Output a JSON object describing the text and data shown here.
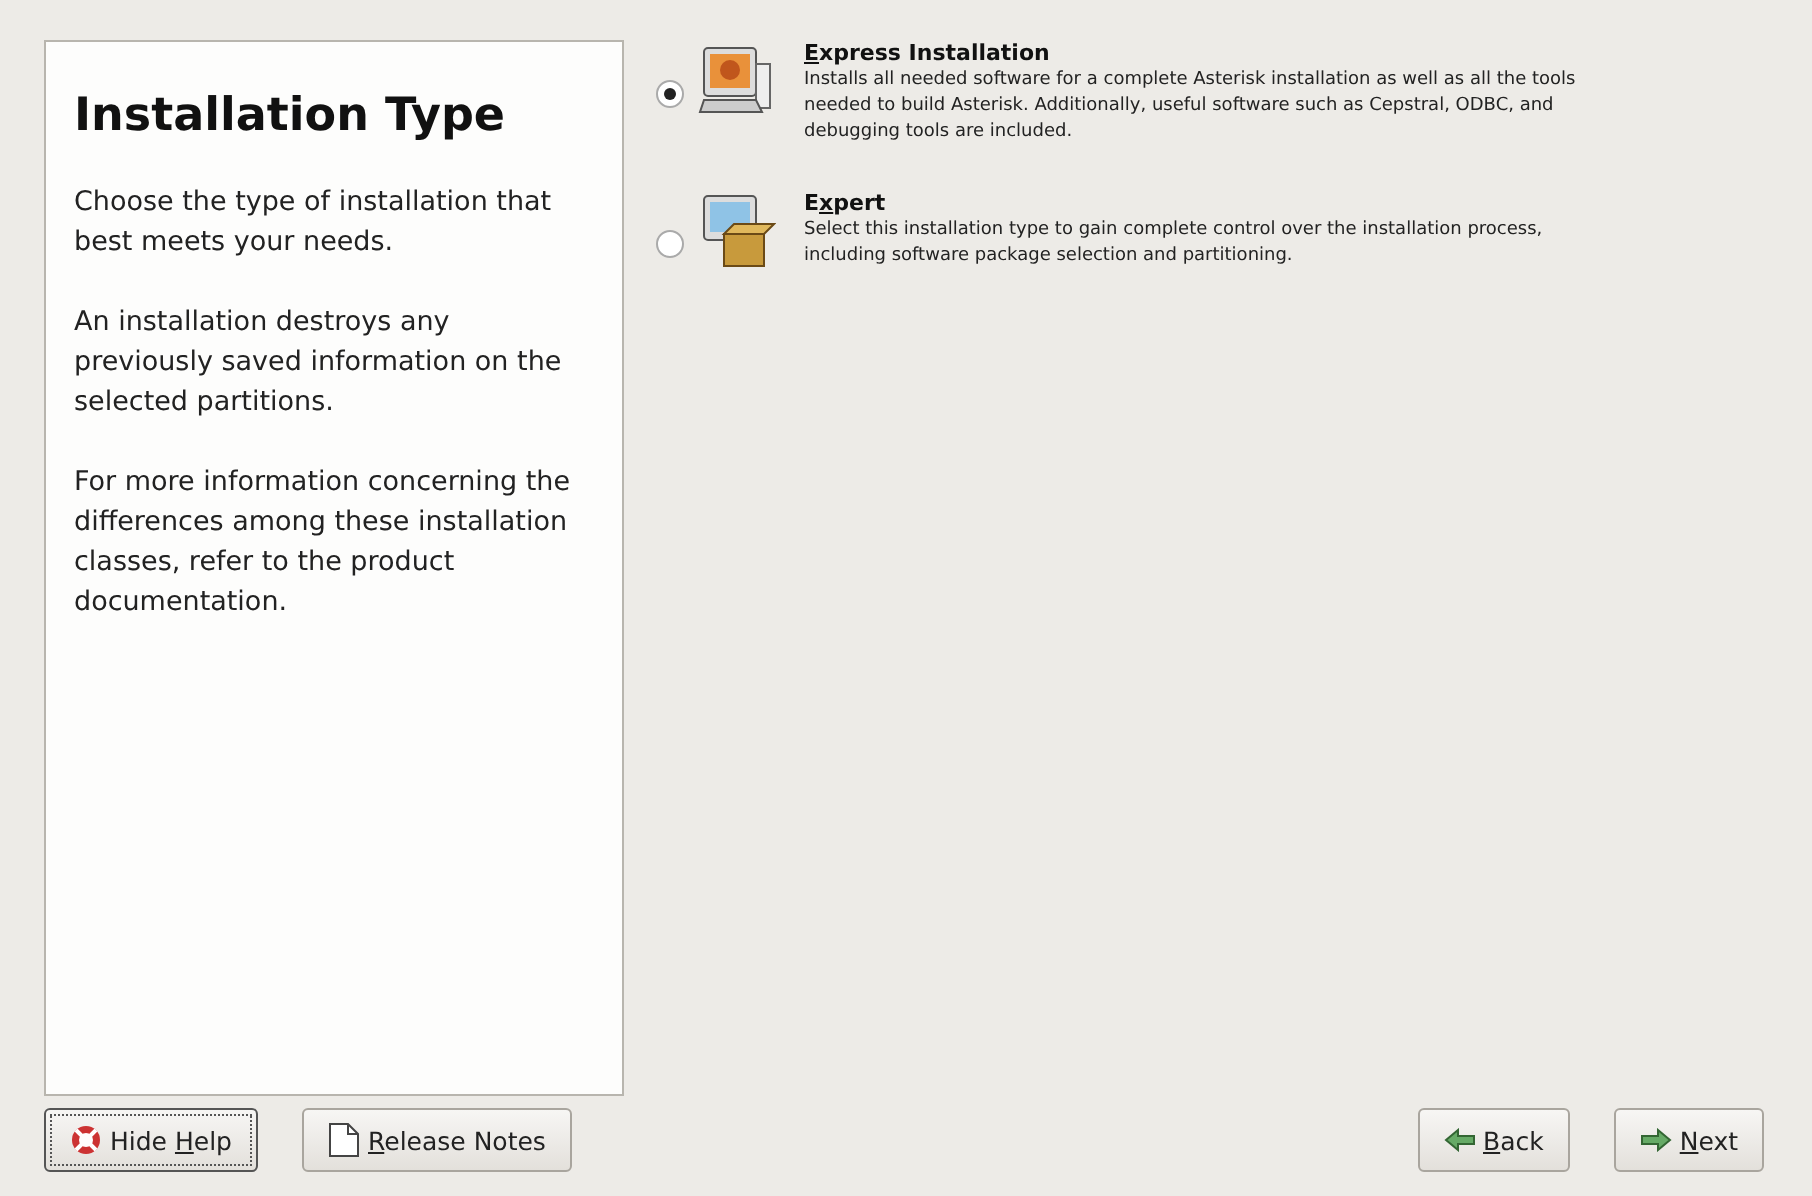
{
  "help": {
    "title": "Installation Type",
    "paragraphs": [
      "Choose the type of installation that best meets your needs.",
      "An installation destroys any previously saved information on the selected partitions.",
      "For more information concerning the differences among these installation classes, refer to the product documentation."
    ]
  },
  "options": [
    {
      "kind": "express",
      "title": {
        "key": "E",
        "post": "xpress Installation"
      },
      "description": "Installs all needed software for a complete Asterisk installation as well as all the tools needed to build Asterisk. Additionally, useful software such as Cepstral, ODBC, and debugging tools are included.",
      "selected": true
    },
    {
      "kind": "expert",
      "title": {
        "pre": "E",
        "key": "x",
        "post": "pert"
      },
      "description": "Select this installation type to gain complete control over the installation process, including software package selection and partitioning.",
      "selected": false
    }
  ],
  "buttons_left": [
    {
      "kind": "hide-help",
      "label": {
        "pre": "Hide ",
        "key": "H",
        "post": "elp"
      },
      "focused": true
    },
    {
      "kind": "release-notes",
      "label": {
        "key": "R",
        "post": "elease Notes"
      },
      "focused": false
    }
  ],
  "buttons_right": [
    {
      "kind": "back",
      "label": {
        "key": "B",
        "post": "ack"
      },
      "focused": false
    },
    {
      "kind": "next",
      "label": {
        "key": "N",
        "post": "ext"
      },
      "focused": false
    }
  ]
}
